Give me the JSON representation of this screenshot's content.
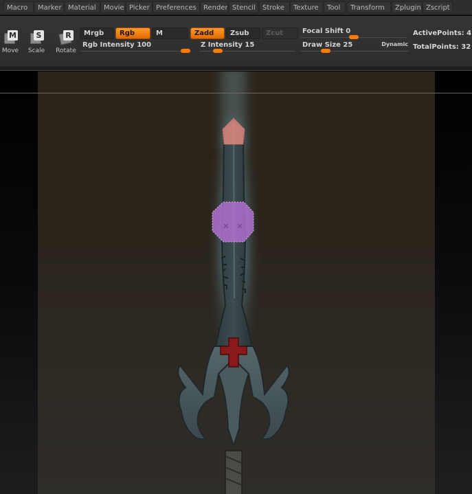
{
  "menu": {
    "items": [
      "Macro",
      "Marker",
      "Material",
      "Movie",
      "Picker",
      "Preferences",
      "Render",
      "Stencil",
      "Stroke",
      "Texture",
      "Tool",
      "Transform",
      "Zplugin",
      "Zscript"
    ]
  },
  "transform": {
    "move": {
      "icon_letter": "M",
      "label": "Move"
    },
    "scale": {
      "icon_letter": "S",
      "label": "Scale"
    },
    "rotate": {
      "icon_letter": "R",
      "label": "Rotate"
    }
  },
  "color_modes": {
    "mrgb": "Mrgb",
    "rgb": "Rgb",
    "m": "M",
    "active": "Rgb"
  },
  "sculpt_modes": {
    "zadd": "Zadd",
    "zsub": "Zsub",
    "zcut": "Zcut",
    "active": "Zadd"
  },
  "sliders": {
    "rgb_intensity": {
      "label": "Rgb  Intensity",
      "value": "100",
      "fraction": 1.0
    },
    "z_intensity": {
      "label": "Z  Intensity",
      "value": "15",
      "fraction": 0.15
    },
    "focal_shift": {
      "label": "Focal  Shift",
      "value": "0",
      "fraction": 0.5
    },
    "draw_size": {
      "label": "Draw  Size",
      "value": "25",
      "fraction": 0.2,
      "extra": "Dynamic"
    }
  },
  "stats": {
    "active_points": "ActivePoints: 4",
    "total_points": "TotalPoints: 32"
  },
  "colors": {
    "accent_orange": "#ff7a00",
    "toolbar_bg": "#333333",
    "canvas_bg": "#2b2419",
    "blade_glow": "#8fd6ef",
    "tip_mask": "#e08a80",
    "gem_mask": "#b070d0",
    "cross_red": "#8a1a1a"
  }
}
